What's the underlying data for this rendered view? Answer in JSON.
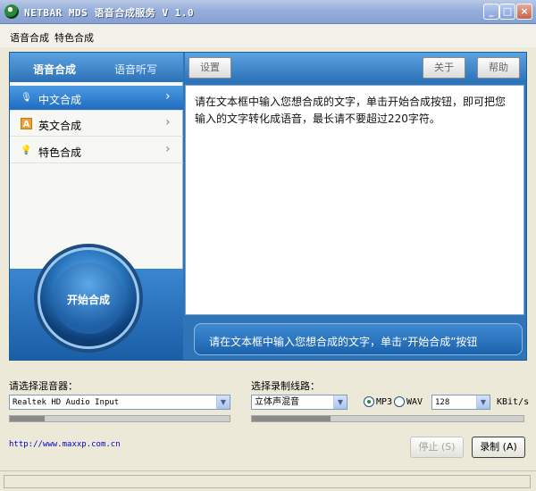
{
  "window": {
    "title": "NETBAR MDS 语音合成服务 V 1.0"
  },
  "menu": {
    "items": [
      "语音合成",
      "特色合成"
    ]
  },
  "left_tabs": {
    "tts": "语音合成",
    "dictation": "语音听写"
  },
  "left_items": [
    {
      "label": "中文合成",
      "icon": "microphone-icon"
    },
    {
      "label": "英文合成",
      "icon": "letter-a-icon"
    },
    {
      "label": "特色合成",
      "icon": "bulb-icon"
    }
  ],
  "start_button": "开始合成",
  "toolbar": {
    "settings": "设置",
    "about": "关于",
    "help": "帮助"
  },
  "text_content": "请在文本框中输入您想合成的文字，单击开始合成按钮，即可把您输入的文字转化成语音，最长请不要超过220字符。",
  "hint": "请在文本框中输入您想合成的文字，单击“开始合成”按钮",
  "mixer": {
    "label": "请选择混音器：",
    "value": "Realtek HD Audio Input",
    "level": 0.16
  },
  "line": {
    "label": "选择录制线路：",
    "value": "立体声混音",
    "level": 0.29
  },
  "format": {
    "mp3": "MP3",
    "wav": "WAV",
    "selected": "MP3"
  },
  "bitrate": {
    "value": "128",
    "unit": "KBit/s"
  },
  "url": "http://www.maxxp.com.cn",
  "buttons": {
    "stop": "停止 (S)",
    "record": "录制 (A)"
  }
}
